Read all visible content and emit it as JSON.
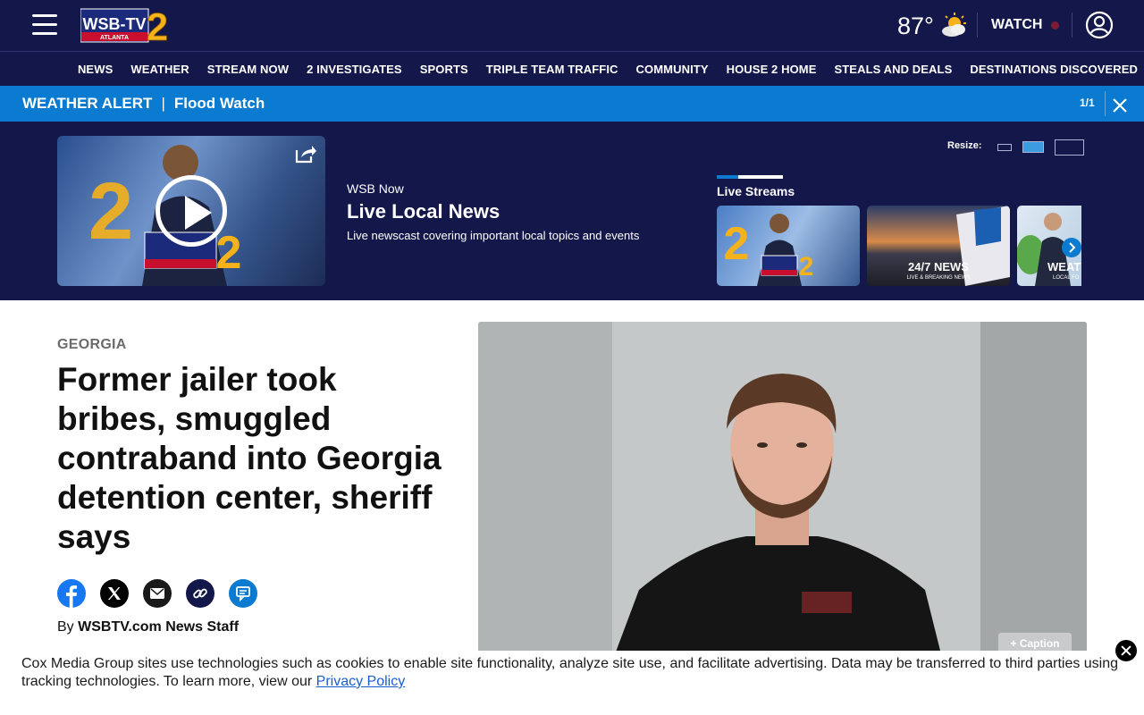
{
  "header": {
    "logo_text": "WSB-TV",
    "logo_city": "ATLANTA",
    "logo_number": "2",
    "temperature": "87°",
    "watch_label": "WATCH"
  },
  "nav": {
    "items": [
      "NEWS",
      "WEATHER",
      "STREAM NOW",
      "2 INVESTIGATES",
      "SPORTS",
      "TRIPLE TEAM TRAFFIC",
      "COMMUNITY",
      "HOUSE 2 HOME",
      "STEALS AND DEALS",
      "DESTINATIONS DISCOVERED"
    ]
  },
  "alert": {
    "label": "WEATHER ALERT",
    "separator": "|",
    "text": "Flood Watch",
    "count": "1/1"
  },
  "video": {
    "overline": "WSB Now",
    "title": "Live Local News",
    "description": "Live newscast covering important local topics and events",
    "resize_label": "Resize:",
    "live_streams_label": "Live Streams",
    "streams": [
      {
        "label": "",
        "sub": ""
      },
      {
        "label": "24/7 NEWS",
        "sub": "LIVE & BREAKING NEWS"
      },
      {
        "label": "WEAT",
        "sub": "LOCAL FO"
      }
    ]
  },
  "article": {
    "section": "GEORGIA",
    "headline": "Former jailer took bribes, smuggled contraband into Georgia detention center, sheriff says",
    "byline_prefix": "By",
    "byline_author": "WSBTV.com News Staff",
    "caption_button": "+ Caption"
  },
  "cookie": {
    "text": "Cox Media Group sites use technologies such as cookies to enable site functionality, analyze site use, and facilitate advertising. Data may be transferred to third parties using tracking technologies. To learn more, view our ",
    "link_text": "Privacy Policy"
  },
  "colors": {
    "navy": "#14174a",
    "alert_blue": "#0a7bd0",
    "facebook": "#1877f2",
    "link": "#1a5cd1"
  }
}
